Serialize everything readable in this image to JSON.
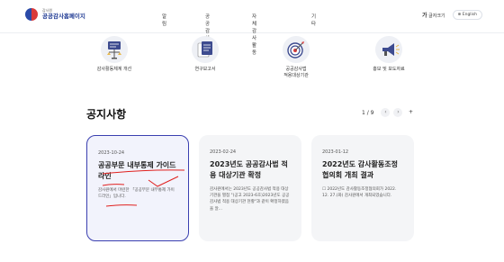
{
  "header": {
    "logo_sub": "감사원",
    "logo_main": "공공감사홈페이지",
    "nav": [
      "알림",
      "공공감사",
      "자체감사활동",
      "기타"
    ],
    "font_label": "글자크기",
    "font_glyph": "가",
    "lang_label": "English"
  },
  "quick_links": [
    {
      "icon": "scales-presentation-icon",
      "label": "감사활동체계 개선"
    },
    {
      "icon": "document-report-icon",
      "label": "연구보고서"
    },
    {
      "icon": "target-icon",
      "label": "공공감사법\n적용대상기관"
    },
    {
      "icon": "megaphone-icon",
      "label": "홍보 및 보도자료"
    }
  ],
  "notice": {
    "title": "공지사항",
    "page": "1 / 9",
    "prev": "‹",
    "next": "›",
    "more": "+",
    "cards": [
      {
        "date": "2023-10-24",
        "title": "공공부문 내부통제 가이드라인",
        "desc": "감사원에서 마련한 「공공부문 내부통제 가이드라인」입니다."
      },
      {
        "date": "2023-02-24",
        "title": "2023년도 공공감사법 적용 대상기관 확정",
        "desc": "감사원에서는 2023년도 공공감사법 적용 대상기관을 별첨 \"(공고 2023-6호)2023년도 공공감사법 적용 대상기관 현황\"과 같이 확정하였음을 알..."
      },
      {
        "date": "2023-01-12",
        "title": "2022년도 감사활동조정협의회 개최 결과",
        "desc": "☐ 2022년도 감사활동조정협의회가 2022. 12. 27.(화) 감사원에서 개최되었습니다."
      }
    ]
  },
  "colors": {
    "accent": "#3a3fb0",
    "annotation": "#e0201e"
  }
}
